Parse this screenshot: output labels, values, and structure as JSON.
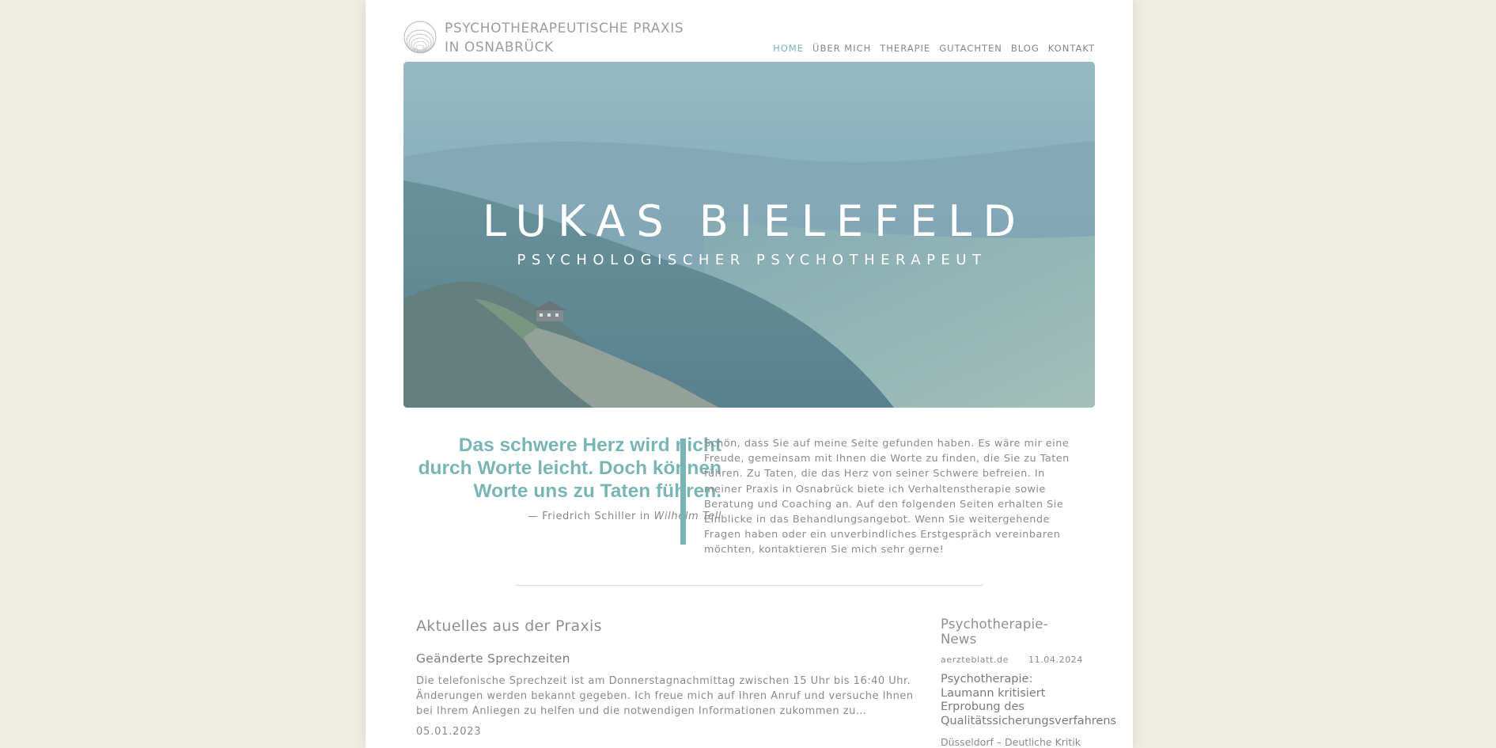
{
  "header": {
    "brand_line1": "PSYCHOTHERAPEUTISCHE PRAXIS",
    "brand_line2": "IN OSNABRÜCK"
  },
  "nav": {
    "items": [
      {
        "label": "HOME",
        "active": true
      },
      {
        "label": "ÜBER MICH"
      },
      {
        "label": "THERAPIE"
      },
      {
        "label": "GUTACHTEN"
      },
      {
        "label": "BLOG"
      },
      {
        "label": "KONTAKT"
      }
    ]
  },
  "hero": {
    "title": "LUKAS BIELEFELD",
    "subtitle": "PSYCHOLOGISCHER PSYCHOTHERAPEUT"
  },
  "quote": {
    "text": "Das schwere Herz wird nicht durch Worte leicht. Doch können Worte uns zu Taten führen.",
    "source_prefix": "— Friedrich Schiller in ",
    "source_work": "Wilhelm Tell"
  },
  "intro": {
    "text": "Schön, dass Sie auf meine Seite gefunden haben. Es wäre mir eine Freude, gemeinsam mit Ihnen die Worte zu finden, die Sie zu Taten führen. Zu Taten, die das Herz von seiner Schwere befreien. In meiner Praxis in Osnabrück biete ich Verhaltenstherapie sowie Beratung und Coaching an. Auf den folgenden Seiten erhalten Sie Einblicke in das Behandlungsangebot. Wenn Sie weitergehende Fragen haben oder ein unverbindliches Erstgespräch vereinbaren möchten, kontaktieren Sie mich sehr gerne!"
  },
  "news": {
    "title": "Aktuelles aus der Praxis",
    "post": {
      "title": "Geänderte Sprechzeiten",
      "body": "Die telefonische Sprechzeit ist am Donnerstagnachmittag zwischen 15 Uhr bis 16:40 Uhr. Änderungen werden bekannt gegeben. Ich freue mich auf Ihren Anruf und versuche Ihnen bei Ihrem Anliegen zu helfen und die notwendigen Informationen zukommen zu…",
      "date": "05.01.2023"
    }
  },
  "sidebar": {
    "title": "Psychotherapie-News",
    "item": {
      "source": "aerzteblatt.de",
      "date": "11.04.2024",
      "headline": "Psychotherapie: Laumann kritisiert Erprobung des Qualitätssicherungsverfahrens",
      "excerpt": "Düsseldorf – Deutliche Kritik an der Erprobung für ein Qua-"
    }
  },
  "colors": {
    "accent": "#7ab5b6",
    "background": "#efede3"
  }
}
